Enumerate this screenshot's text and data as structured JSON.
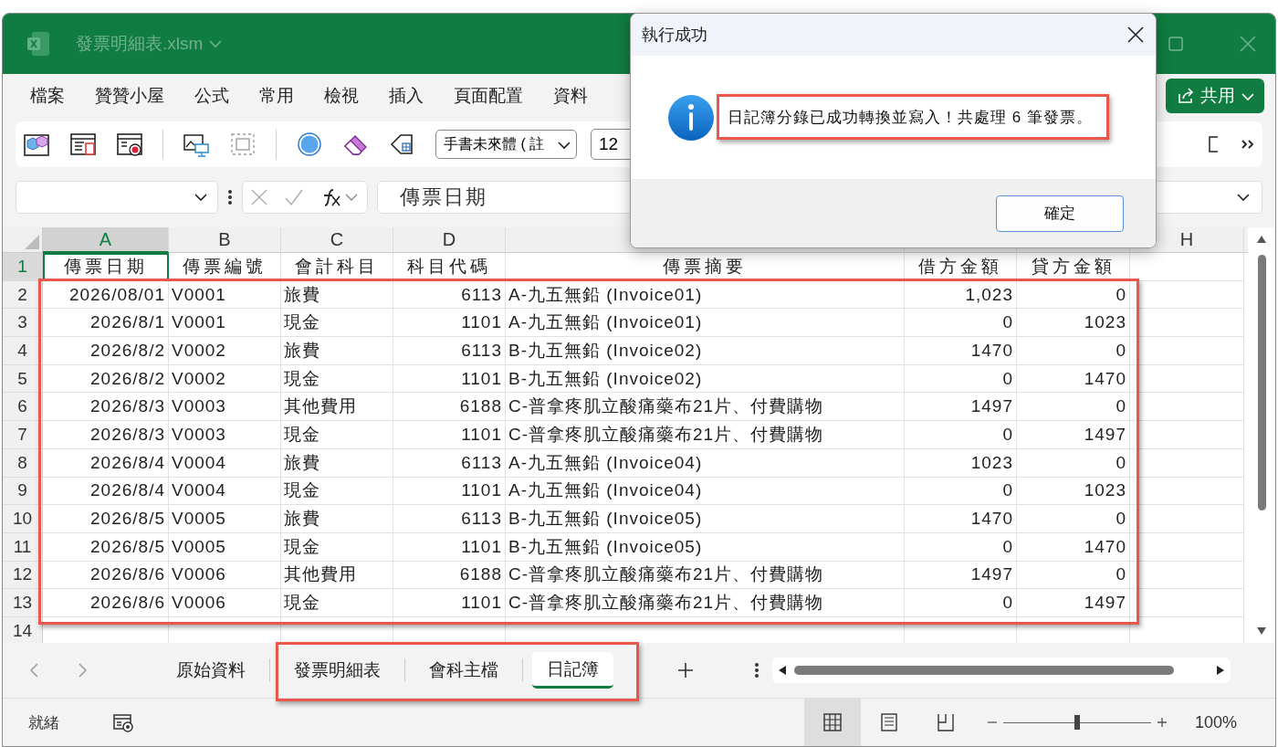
{
  "title_bar": {
    "file_name": "發票明細表.xlsm"
  },
  "menu": [
    "檔案",
    "贊贊小屋",
    "公式",
    "常用",
    "檢視",
    "插入",
    "頁面配置",
    "資料"
  ],
  "share_button": "共用",
  "toolbar": {
    "font_name": "手書未來體 ( 註",
    "font_size": "12"
  },
  "formula_bar": {
    "formula": "傳票日期"
  },
  "sheet": {
    "columns": [
      {
        "label": "A",
        "selected": true
      },
      {
        "label": "B",
        "selected": false
      },
      {
        "label": "C",
        "selected": false
      },
      {
        "label": "D",
        "selected": false
      },
      {
        "selected": false
      },
      {
        "selected": false
      },
      {
        "selected": false
      },
      {
        "label": "H",
        "selected": false
      }
    ],
    "rows": [
      {
        "number": "1",
        "selected": true,
        "kind": "header",
        "cells": [
          "傳票日期",
          "傳票編號",
          "會計科目",
          "科目代碼",
          "傳票摘要",
          "借方金額",
          "貸方金額"
        ]
      },
      {
        "number": "2",
        "selected": false,
        "kind": "data",
        "cells": [
          "2026/08/01",
          "V0001",
          "旅費",
          "6113",
          "A-九五無鉛 (Invoice01)",
          "1,023",
          "0"
        ]
      },
      {
        "number": "3",
        "selected": false,
        "kind": "data",
        "cells": [
          "2026/8/1",
          "V0001",
          "現金",
          "1101",
          "A-九五無鉛 (Invoice01)",
          "0",
          "1023"
        ]
      },
      {
        "number": "4",
        "selected": false,
        "kind": "data",
        "cells": [
          "2026/8/2",
          "V0002",
          "旅費",
          "6113",
          "B-九五無鉛 (Invoice02)",
          "1470",
          "0"
        ]
      },
      {
        "number": "5",
        "selected": false,
        "kind": "data",
        "cells": [
          "2026/8/2",
          "V0002",
          "現金",
          "1101",
          "B-九五無鉛 (Invoice02)",
          "0",
          "1470"
        ]
      },
      {
        "number": "6",
        "selected": false,
        "kind": "data",
        "cells": [
          "2026/8/3",
          "V0003",
          "其他費用",
          "6188",
          "C-普拿疼肌立酸痛藥布21片、付費購物",
          "1497",
          "0"
        ]
      },
      {
        "number": "7",
        "selected": false,
        "kind": "data",
        "cells": [
          "2026/8/3",
          "V0003",
          "現金",
          "1101",
          "C-普拿疼肌立酸痛藥布21片、付費購物",
          "0",
          "1497"
        ]
      },
      {
        "number": "8",
        "selected": false,
        "kind": "data",
        "cells": [
          "2026/8/4",
          "V0004",
          "旅費",
          "6113",
          "A-九五無鉛 (Invoice04)",
          "1023",
          "0"
        ]
      },
      {
        "number": "9",
        "selected": false,
        "kind": "data",
        "cells": [
          "2026/8/4",
          "V0004",
          "現金",
          "1101",
          "A-九五無鉛 (Invoice04)",
          "0",
          "1023"
        ]
      },
      {
        "number": "10",
        "selected": false,
        "kind": "data",
        "cells": [
          "2026/8/5",
          "V0005",
          "旅費",
          "6113",
          "B-九五無鉛 (Invoice05)",
          "1470",
          "0"
        ]
      },
      {
        "number": "11",
        "selected": false,
        "kind": "data",
        "cells": [
          "2026/8/5",
          "V0005",
          "現金",
          "1101",
          "B-九五無鉛 (Invoice05)",
          "0",
          "1470"
        ]
      },
      {
        "number": "12",
        "selected": false,
        "kind": "data",
        "cells": [
          "2026/8/6",
          "V0006",
          "其他費用",
          "6188",
          "C-普拿疼肌立酸痛藥布21片、付費購物",
          "1497",
          "0"
        ]
      },
      {
        "number": "13",
        "selected": false,
        "kind": "data",
        "cells": [
          "2026/8/6",
          "V0006",
          "現金",
          "1101",
          "C-普拿疼肌立酸痛藥布21片、付費購物",
          "0",
          "1497"
        ]
      },
      {
        "number": "14",
        "selected": false,
        "kind": "data",
        "cells": []
      }
    ]
  },
  "sheet_tabs": [
    {
      "label": "原始資料",
      "selected": false
    },
    {
      "label": "發票明細表",
      "selected": false
    },
    {
      "label": "會科主檔",
      "selected": false
    },
    {
      "label": "日記簿",
      "selected": true
    }
  ],
  "status_bar": {
    "status": "就緒",
    "view_buttons": [
      {
        "kind": "normal",
        "selected": true
      },
      {
        "kind": "page_layout",
        "selected": false
      },
      {
        "kind": "page_break",
        "selected": false
      }
    ],
    "zoom": {
      "level": 0.5,
      "reading": "100%"
    }
  },
  "dialog": {
    "title": "執行成功",
    "message": "日記簿分錄已成功轉換並寫入！共處理 6 筆發票。",
    "ok_button": "確定"
  }
}
